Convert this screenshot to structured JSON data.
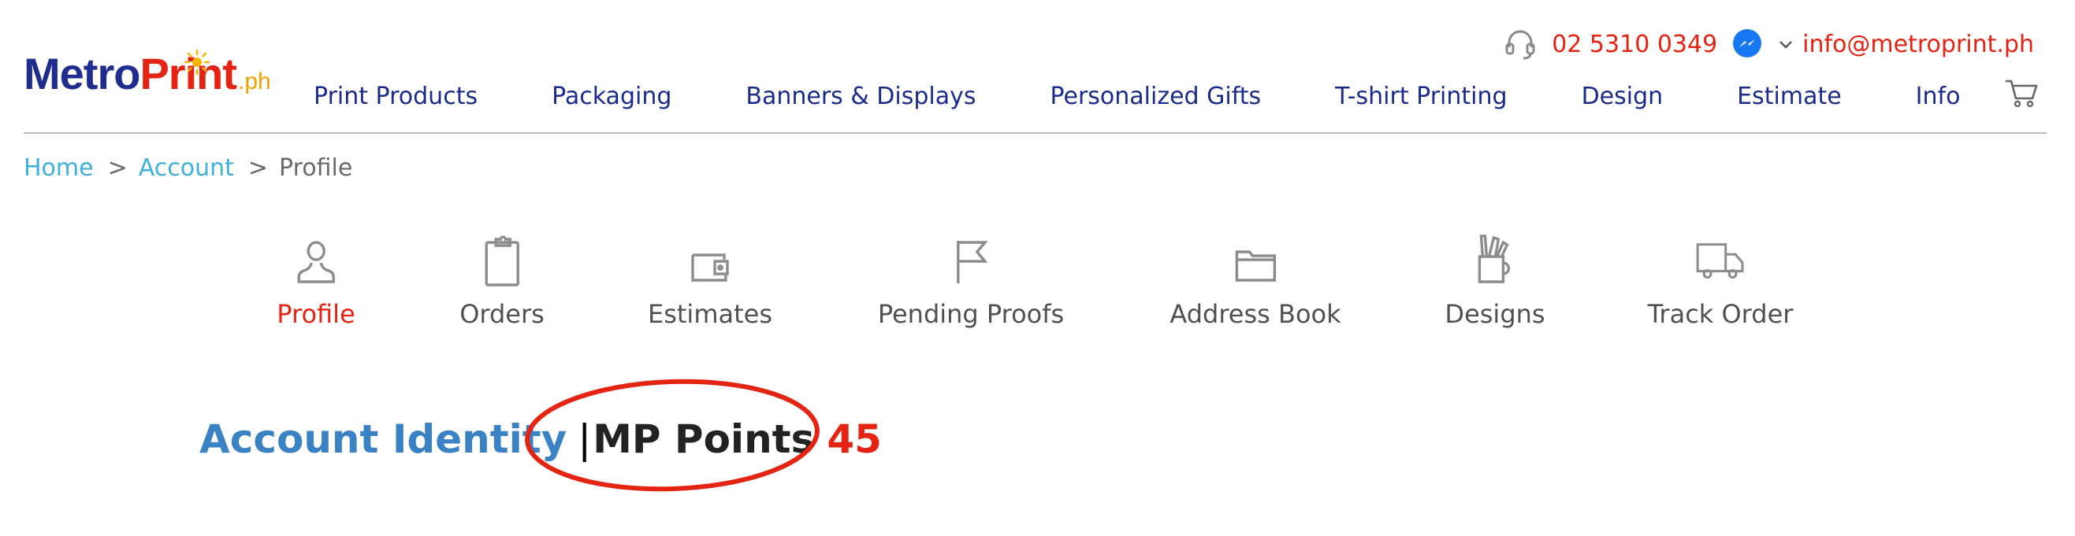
{
  "header": {
    "logo": {
      "metro": "Metro",
      "print": "Print",
      "ph": ".ph"
    },
    "phone": "02 5310 0349",
    "email": "info@metroprint.ph",
    "nav": [
      "Print Products",
      "Packaging",
      "Banners & Displays",
      "Personalized Gifts",
      "T-shirt Printing",
      "Design",
      "Estimate",
      "Info"
    ],
    "icons": {
      "phone": "headset-icon",
      "messenger": "messenger-icon",
      "dropdown": "chevron-down-icon",
      "cart": "cart-icon"
    }
  },
  "breadcrumb": {
    "home": "Home",
    "account": "Account",
    "current": "Profile",
    "separator": ">"
  },
  "tabs": [
    {
      "label": "Profile",
      "icon": "user-icon",
      "active": true
    },
    {
      "label": "Orders",
      "icon": "clipboard-icon",
      "active": false
    },
    {
      "label": "Estimates",
      "icon": "wallet-icon",
      "active": false
    },
    {
      "label": "Pending Proofs",
      "icon": "flag-icon",
      "active": false
    },
    {
      "label": "Address Book",
      "icon": "folder-icon",
      "active": false
    },
    {
      "label": "Designs",
      "icon": "design-tools-cup-icon",
      "active": false
    },
    {
      "label": "Track Order",
      "icon": "truck-icon",
      "active": false
    }
  ],
  "identity": {
    "title": "Account Identity",
    "separator": "|",
    "points_label": "MP Points",
    "points_value": "45"
  },
  "colors": {
    "brand_blue": "#1a2b8c",
    "brand_red": "#e42313",
    "link_cyan": "#3eb0dc",
    "identity_blue": "#3b82c4",
    "messenger_blue": "#1877f2"
  }
}
